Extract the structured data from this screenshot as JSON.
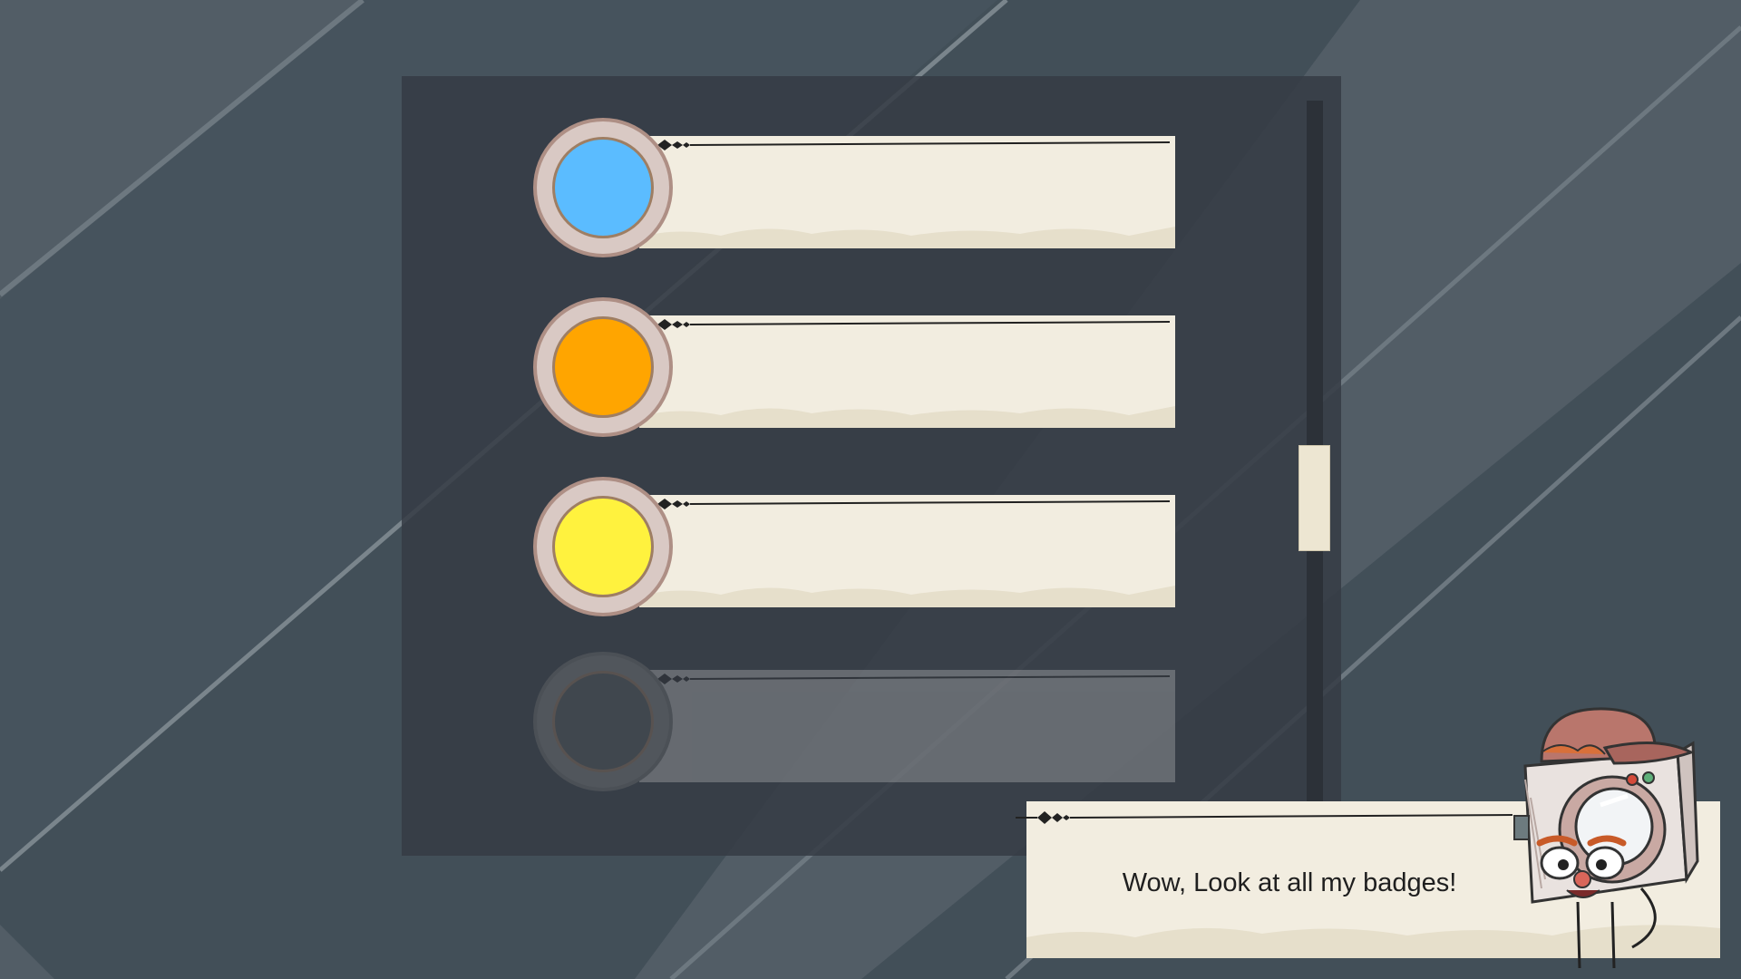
{
  "dialog": {
    "text": "Wow, Look at all my badges!"
  },
  "badges": [
    {
      "color": "#5bbcff",
      "unlocked": true
    },
    {
      "color": "#ffa500",
      "unlocked": true
    },
    {
      "color": "#fff23e",
      "unlocked": true
    },
    {
      "color": "#555a5d",
      "unlocked": false
    }
  ],
  "colors": {
    "background": "#424f58",
    "panel": "#353b44",
    "banner": "#f2ede0",
    "coin_ring": "#d9c9c4"
  },
  "scrollbar": {
    "position_fraction": 0.5
  },
  "icons": [
    "badge-coin-icon",
    "character-camera-head"
  ]
}
